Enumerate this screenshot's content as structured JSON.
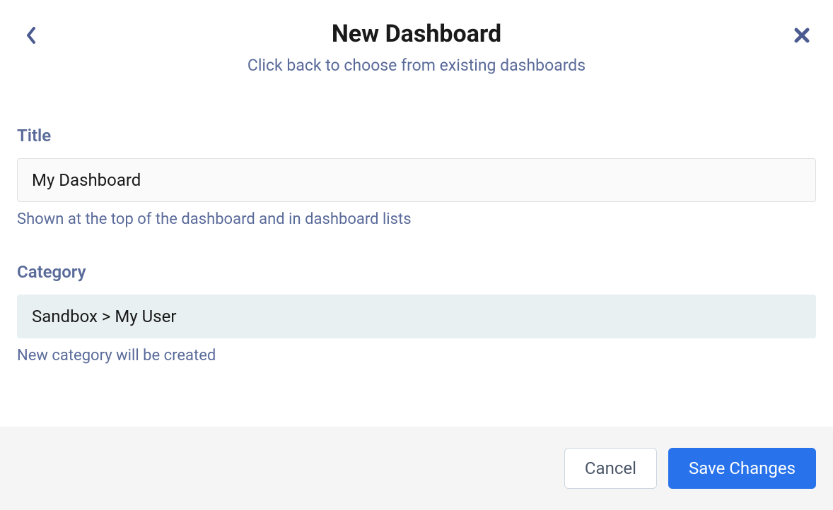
{
  "header": {
    "title": "New Dashboard",
    "subtitle": "Click back to choose from existing dashboards"
  },
  "form": {
    "title": {
      "label": "Title",
      "value": "My Dashboard",
      "hint": "Shown at the top of the dashboard and in dashboard lists"
    },
    "category": {
      "label": "Category",
      "value": "Sandbox > My User",
      "hint": "New category will be created"
    }
  },
  "footer": {
    "cancel_label": "Cancel",
    "save_label": "Save Changes"
  }
}
